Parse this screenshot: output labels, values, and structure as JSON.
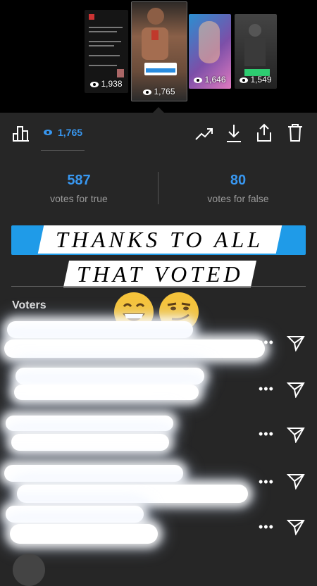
{
  "stories": [
    {
      "views": "1,938"
    },
    {
      "views": "1,765"
    },
    {
      "views": "1,646"
    },
    {
      "views": "1,549"
    }
  ],
  "toolbar": {
    "views": "1,765",
    "icons": [
      "insights-icon",
      "eye-icon",
      "trending-icon",
      "download-icon",
      "share-icon",
      "trash-icon"
    ]
  },
  "poll": {
    "true_count": "587",
    "true_label": "votes for true",
    "false_count": "80",
    "false_label": "votes for false"
  },
  "overlay": {
    "line1": "THANKS TO ALL",
    "line2": "THAT VOTED",
    "emojis": [
      "grinning-face",
      "smirking-face"
    ]
  },
  "voters_label": "Voters",
  "colors": {
    "accent": "#3897f0",
    "banner_blue": "#1f9be8",
    "background": "#262626"
  }
}
